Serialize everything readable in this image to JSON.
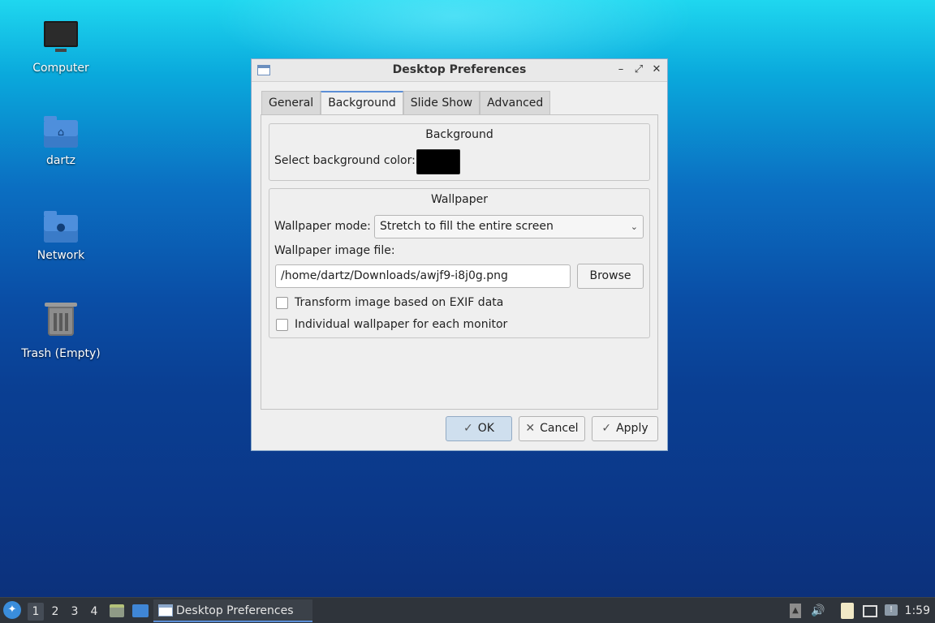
{
  "desktop": {
    "icons": [
      {
        "label": "Computer",
        "icon": "computer-icon"
      },
      {
        "label": "dartz",
        "icon": "home-folder-icon"
      },
      {
        "label": "Network",
        "icon": "network-folder-icon"
      },
      {
        "label": "Trash (Empty)",
        "icon": "trash-icon"
      }
    ]
  },
  "dialog": {
    "title": "Desktop Preferences",
    "tabs": [
      {
        "label": "General"
      },
      {
        "label": "Background"
      },
      {
        "label": "Slide Show"
      },
      {
        "label": "Advanced"
      }
    ],
    "active_tab": "Background",
    "background_group": {
      "title": "Background",
      "color_label": "Select background color:",
      "color_value": "#000000"
    },
    "wallpaper_group": {
      "title": "Wallpaper",
      "mode_label": "Wallpaper mode:",
      "mode_value": "Stretch to fill the entire screen",
      "file_label": "Wallpaper image file:",
      "file_value": "/home/dartz/Downloads/awjf9-i8j0g.png",
      "browse_label": "Browse",
      "exif_label": "Transform image based on EXIF data",
      "exif_checked": false,
      "per_monitor_label": "Individual wallpaper for each monitor",
      "per_monitor_checked": false
    },
    "buttons": {
      "ok": "OK",
      "cancel": "Cancel",
      "apply": "Apply"
    }
  },
  "taskbar": {
    "workspaces": [
      "1",
      "2",
      "3",
      "4"
    ],
    "active_workspace": "1",
    "task_label": "Desktop Preferences",
    "clock": "1:59"
  },
  "colors": {
    "accent": "#5b8ed6",
    "taskbar_bg": "#2f343b",
    "ok_button_bg": "#cfdfee"
  }
}
